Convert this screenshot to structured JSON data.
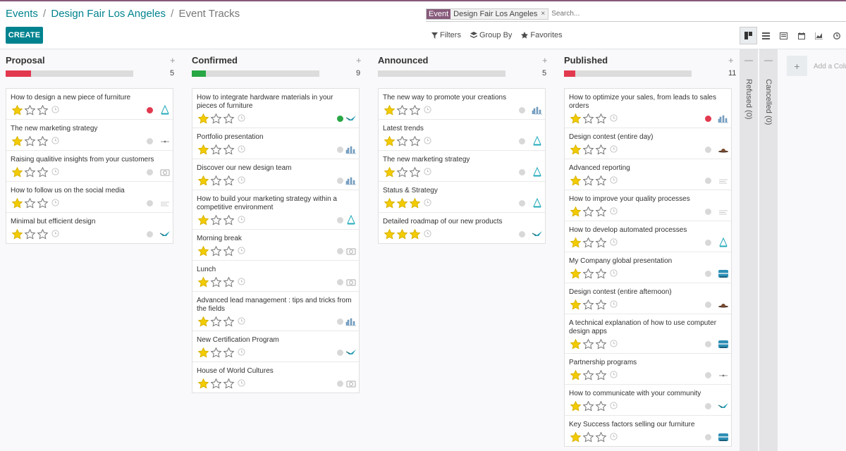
{
  "breadcrumb": {
    "events": "Events",
    "sep1": "/",
    "event": "Design Fair Los Angeles",
    "sep2": "/",
    "current": "Event Tracks"
  },
  "create_label": "CREATE",
  "search": {
    "facet_label": "Event",
    "facet_value": "Design Fair Los Angeles",
    "facet_remove": "×",
    "placeholder": "Search..."
  },
  "filters": {
    "filters": "Filters",
    "group_by": "Group By",
    "favorites": "Favorites"
  },
  "views": [
    "kanban-view-icon",
    "list-view-icon",
    "form-view-icon",
    "calendar-view-icon",
    "graph-view-icon",
    "activity-view-icon"
  ],
  "colors": {
    "accent": "#875a7b",
    "teal": "#00838f",
    "star": "#f3cc00",
    "red": "#e2394f",
    "green": "#28a745"
  },
  "columns": [
    {
      "title": "Proposal",
      "count": "5",
      "fill_pct": 20,
      "fill_color": "#e2394f",
      "cards": [
        {
          "title": "How to design a new piece of furniture",
          "stars": 1,
          "status": "red",
          "logo": "triangle"
        },
        {
          "title": "The new marketing strategy",
          "stars": 1,
          "status": "grey",
          "logo": "dash"
        },
        {
          "title": "Raising qualitive insights from your customers",
          "stars": 1,
          "status": "grey",
          "logo": "camera"
        },
        {
          "title": "How to follow us on the social media",
          "stars": 1,
          "status": "grey",
          "logo": "text"
        },
        {
          "title": "Minimal but efficient design",
          "stars": 1,
          "status": "grey",
          "logo": "bird"
        }
      ]
    },
    {
      "title": "Confirmed",
      "count": "9",
      "fill_pct": 11,
      "fill_color": "#28a745",
      "cards": [
        {
          "title": "How to integrate hardware materials in your pieces of furniture",
          "stars": 1,
          "status": "green",
          "logo": "bird"
        },
        {
          "title": "Portfolio presentation",
          "stars": 1,
          "status": "grey",
          "logo": "city"
        },
        {
          "title": "Discover our new design team",
          "stars": 1,
          "status": "grey",
          "logo": "city"
        },
        {
          "title": "How to build your marketing strategy within a competitive environment",
          "stars": 1,
          "status": "grey",
          "logo": "triangle"
        },
        {
          "title": "Morning break",
          "stars": 1,
          "status": "grey",
          "logo": "camera"
        },
        {
          "title": "Lunch",
          "stars": 1,
          "status": "grey",
          "logo": "camera"
        },
        {
          "title": "Advanced lead management : tips and tricks from the fields",
          "stars": 1,
          "status": "grey",
          "logo": "city"
        },
        {
          "title": "New Certification Program",
          "stars": 1,
          "status": "grey",
          "logo": "bird"
        },
        {
          "title": "House of World Cultures",
          "stars": 1,
          "status": "grey",
          "logo": "camera"
        }
      ]
    },
    {
      "title": "Announced",
      "count": "5",
      "fill_pct": 0,
      "fill_color": "#e2394f",
      "cards": [
        {
          "title": "The new way to promote your creations",
          "stars": 1,
          "status": "grey",
          "logo": "city"
        },
        {
          "title": "Latest trends",
          "stars": 1,
          "status": "grey",
          "logo": "triangle"
        },
        {
          "title": "The new marketing strategy",
          "stars": 1,
          "status": "grey",
          "logo": "triangle"
        },
        {
          "title": "Status & Strategy",
          "stars": 3,
          "status": "grey",
          "logo": "triangle"
        },
        {
          "title": "Detailed roadmap of our new products",
          "stars": 3,
          "status": "grey",
          "logo": "bird"
        }
      ]
    },
    {
      "title": "Published",
      "count": "11",
      "fill_pct": 9,
      "fill_color": "#e2394f",
      "cards": [
        {
          "title": "How to optimize your sales, from leads to sales orders",
          "stars": 1,
          "status": "red",
          "logo": "city"
        },
        {
          "title": "Design contest (entire day)",
          "stars": 1,
          "status": "grey",
          "logo": "hat"
        },
        {
          "title": "Advanced reporting",
          "stars": 1,
          "status": "grey",
          "logo": "text"
        },
        {
          "title": "How to improve your quality processes",
          "stars": 1,
          "status": "grey",
          "logo": "text"
        },
        {
          "title": "How to develop automated processes",
          "stars": 1,
          "status": "grey",
          "logo": "triangle"
        },
        {
          "title": "My Company global presentation",
          "stars": 1,
          "status": "grey",
          "logo": "globe"
        },
        {
          "title": "Design contest (entire afternoon)",
          "stars": 1,
          "status": "grey",
          "logo": "hat"
        },
        {
          "title": "A technical explanation of how to use computer design apps",
          "stars": 1,
          "status": "grey",
          "logo": "globe"
        },
        {
          "title": "Partnership programs",
          "stars": 1,
          "status": "grey",
          "logo": "dash"
        },
        {
          "title": "How to communicate with your community",
          "stars": 1,
          "status": "grey",
          "logo": "bird"
        },
        {
          "title": "Key Success factors selling our furniture",
          "stars": 1,
          "status": "grey",
          "logo": "globe"
        }
      ]
    }
  ],
  "folded": [
    {
      "label": "Refused (0)",
      "minus": "—"
    },
    {
      "label": "Cancelled (0)",
      "minus": "—"
    }
  ],
  "add_column": {
    "plus": "+",
    "label": "Add a Column"
  }
}
